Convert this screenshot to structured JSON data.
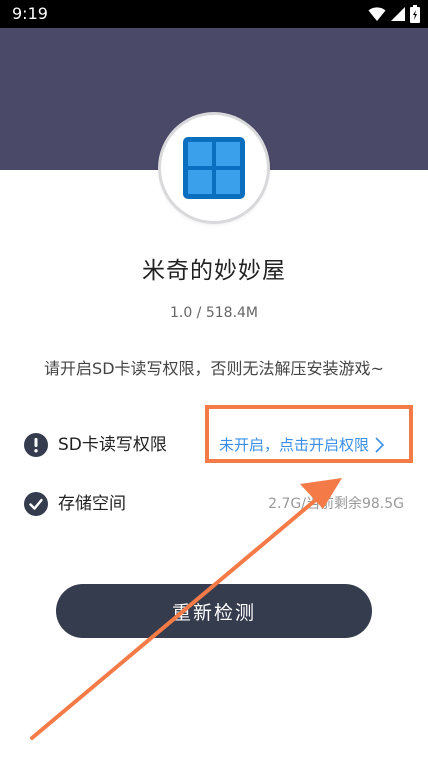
{
  "status_bar": {
    "time": "9:19",
    "icons": [
      "wifi-icon",
      "cell-signal-icon",
      "battery-icon"
    ]
  },
  "app": {
    "icon": "windows-grid-icon",
    "title": "米奇的妙妙屋",
    "meta": "1.0 / 518.4M"
  },
  "hint": "请开启SD卡读写权限，否则无法解压安装游戏~",
  "permissions": {
    "sd": {
      "label": "SD卡读写权限",
      "icon": "warning-circle-icon",
      "action": "未开启，点击开启权限"
    },
    "storage": {
      "label": "存储空间",
      "icon": "check-circle-icon",
      "info": "2.7G/当前剩余98.5G"
    }
  },
  "recheck_button": "重新检测",
  "colors": {
    "header": "#4a4968",
    "accent_link": "#3a8ee6",
    "highlight": "#f47b47",
    "button": "#353c4e"
  }
}
